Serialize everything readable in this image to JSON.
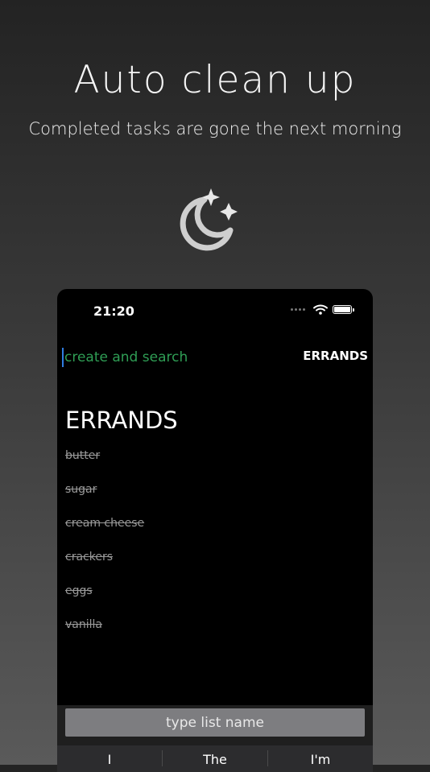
{
  "promo": {
    "title": "Auto clean up",
    "subtitle": "Completed tasks are gone the next morning"
  },
  "status_bar": {
    "time": "21:20"
  },
  "search": {
    "placeholder": "create and search"
  },
  "header": {
    "list_button_label": "ERRANDS"
  },
  "list": {
    "title": "ERRANDS",
    "items": [
      {
        "label": "butter",
        "done": true
      },
      {
        "label": "sugar",
        "done": true
      },
      {
        "label": "cream cheese",
        "done": true
      },
      {
        "label": "crackers",
        "done": true
      },
      {
        "label": "eggs",
        "done": true
      },
      {
        "label": "vanilla",
        "done": true
      }
    ]
  },
  "list_name_input": {
    "placeholder": "type list name"
  },
  "keyboard": {
    "suggestions": [
      "I",
      "The",
      "I'm"
    ]
  },
  "colors": {
    "search_text": "#2f9e55",
    "caret": "#2f7de1",
    "completed_text": "#9a9a9a",
    "input_bg": "#7d7d80"
  },
  "icons": {
    "promo_icon": "moon-stars-icon"
  }
}
